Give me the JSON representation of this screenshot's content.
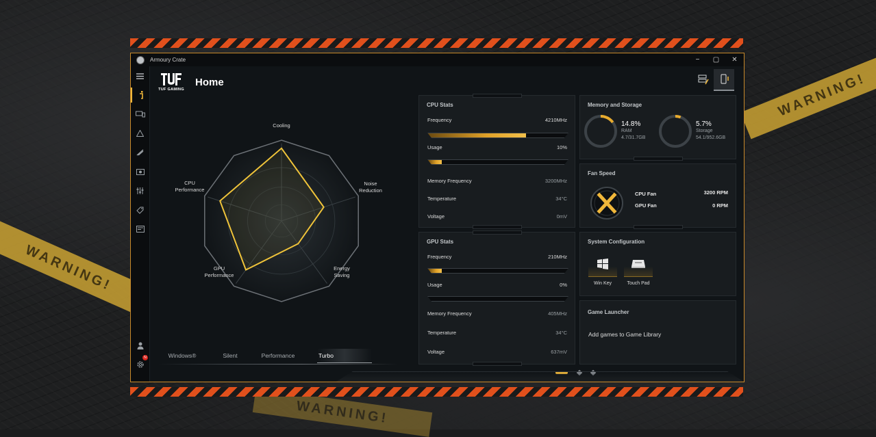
{
  "app": {
    "title": "Armoury Crate"
  },
  "window_controls": {
    "minimize": "−",
    "maximize": "▢",
    "close": "✕"
  },
  "brand": {
    "text": "TUF GAMING"
  },
  "page": {
    "title": "Home"
  },
  "sidebar": {
    "items": [
      {
        "name": "menu-icon"
      },
      {
        "name": "home-icon",
        "active": true
      },
      {
        "name": "device-icon"
      },
      {
        "name": "aura-icon"
      },
      {
        "name": "scenario-icon"
      },
      {
        "name": "media-icon"
      },
      {
        "name": "equalizer-icon"
      },
      {
        "name": "tag-icon"
      },
      {
        "name": "news-icon"
      },
      {
        "name": "user-icon"
      },
      {
        "name": "settings-icon",
        "badge": "N"
      }
    ]
  },
  "radar": {
    "labels": {
      "cooling": "Cooling",
      "noise_1": "Noise",
      "noise_2": "Reduction",
      "energy_1": "Energy",
      "energy_2": "Saving",
      "gpu_1": "GPU",
      "gpu_2": "Performance",
      "cpu_1": "CPU",
      "cpu_2": "Performance"
    },
    "levels": {
      "cooling": 0.9,
      "noise": 0.55,
      "energy": 0.35,
      "gpu": 0.75,
      "cpu": 0.8
    },
    "accent": "#f0c43a"
  },
  "modes": {
    "items": [
      "Windows®",
      "Silent",
      "Performance",
      "Turbo"
    ],
    "active": "Turbo"
  },
  "cpu_stats": {
    "title": "CPU Stats",
    "frequency_label": "Frequency",
    "frequency_value": "4210MHz",
    "frequency_level": 0.7,
    "usage_label": "Usage",
    "usage_value": "10%",
    "usage_level": 0.1,
    "memfreq_label": "Memory Frequency",
    "memfreq_value": "3200MHz",
    "temp_label": "Temperature",
    "temp_value": "34°C",
    "voltage_label": "Voltage",
    "voltage_value": "0mV"
  },
  "gpu_stats": {
    "title": "GPU Stats",
    "frequency_label": "Frequency",
    "frequency_value": "210MHz",
    "frequency_level": 0.1,
    "usage_label": "Usage",
    "usage_value": "0%",
    "usage_level": 0,
    "memfreq_label": "Memory Frequency",
    "memfreq_value": "405MHz",
    "temp_label": "Temperature",
    "temp_value": "34°C",
    "voltage_label": "Voltage",
    "voltage_value": "637mV"
  },
  "memory": {
    "title": "Memory and Storage",
    "ram_percent": "14.8%",
    "ram_label": "RAM",
    "ram_detail": "4.7/31.7GB",
    "ram_level": 0.148,
    "storage_percent": "5.7%",
    "storage_label": "Storage",
    "storage_detail": "54.1/952.6GB",
    "storage_level": 0.057
  },
  "fan": {
    "title": "Fan Speed",
    "cpu_label": "CPU Fan",
    "cpu_value": "3200 RPM",
    "gpu_label": "GPU Fan",
    "gpu_value": "0 RPM"
  },
  "sysconfig": {
    "title": "System Configuration",
    "winkey_label": "Win Key",
    "touchpad_label": "Touch Pad"
  },
  "game_launcher": {
    "title": "Game Launcher",
    "add_text": "Add games to Game Library"
  },
  "tapes": {
    "warning": "WARNING!"
  },
  "colors": {
    "accent": "#f0b73a",
    "hazard": "#e1501c",
    "border": "#c98a2a"
  }
}
